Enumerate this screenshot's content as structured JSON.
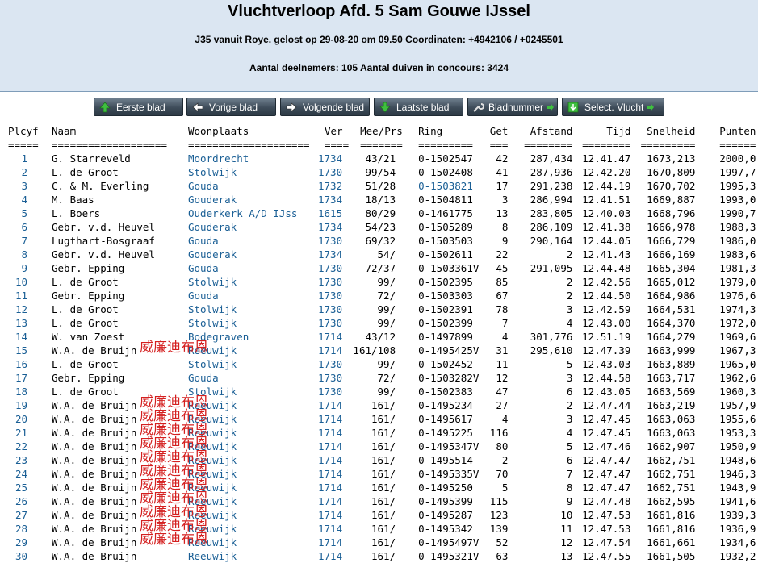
{
  "header": {
    "title": "Vluchtverloop Afd. 5 Sam Gouwe IJssel",
    "subtitle1": "J35 vanuit Roye. gelost op 29-08-20 om 09.50 Coordinaten: +4942106 / +0245501",
    "subtitle2": "Aantal deelnemers: 105 Aantal duiven in concours: 3424"
  },
  "toolbar": {
    "buttons": [
      {
        "name": "eerste-blad-button",
        "label": "Eerste blad",
        "icon": "arrow-up-icon"
      },
      {
        "name": "vorige-blad-button",
        "label": "Vorige blad",
        "icon": "arrow-left-icon"
      },
      {
        "name": "volgende-blad-button",
        "label": "Volgende blad",
        "icon": "arrow-right-icon"
      },
      {
        "name": "laatste-blad-button",
        "label": "Laatste blad",
        "icon": "arrow-down-icon"
      },
      {
        "name": "bladnummer-button",
        "label": "Bladnummer",
        "icon": "wrench-icon"
      },
      {
        "name": "select-vlucht-button",
        "label": "Select. Vlucht",
        "icon": "download-icon"
      }
    ]
  },
  "table": {
    "headers": [
      "Plcyf",
      "Naam",
      "Woonplaats",
      "Ver",
      "Mee/Prs",
      "Ring",
      "Get",
      "Afstand",
      "Tijd",
      "Snelheid",
      "Punten"
    ],
    "separators": [
      "=====",
      "===================",
      "====================",
      "====",
      "=======",
      "=========",
      "===",
      "========",
      "========",
      "=========",
      "======"
    ],
    "rows": [
      [
        "1",
        "G. Starreveld",
        "Moordrecht",
        "1734",
        "43/21",
        "0-1502547",
        "42",
        "287,434",
        "12.41.47",
        "1673,213",
        "2000,0"
      ],
      [
        "2",
        "L. de Groot",
        "Stolwijk",
        "1730",
        "99/54",
        "0-1502408",
        "41",
        "287,936",
        "12.42.20",
        "1670,809",
        "1997,7"
      ],
      [
        "3",
        "C. & M. Everling",
        "Gouda",
        "1732",
        "51/28",
        "0-1503821",
        "17",
        "291,238",
        "12.44.19",
        "1670,702",
        "1995,3"
      ],
      [
        "4",
        "M. Baas",
        "Gouderak",
        "1734",
        "18/13",
        "0-1504811",
        "3",
        "286,994",
        "12.41.51",
        "1669,887",
        "1993,0"
      ],
      [
        "5",
        "L. Boers",
        "Ouderkerk A/D IJss",
        "1615",
        "80/29",
        "0-1461775",
        "13",
        "283,805",
        "12.40.03",
        "1668,796",
        "1990,7"
      ],
      [
        "6",
        "Gebr. v.d. Heuvel",
        "Gouderak",
        "1734",
        "54/23",
        "0-1505289",
        "8",
        "286,109",
        "12.41.38",
        "1666,978",
        "1988,3"
      ],
      [
        "7",
        "Lugthart-Bosgraaf",
        "Gouda",
        "1730",
        "69/32",
        "0-1503503",
        "9",
        "290,164",
        "12.44.05",
        "1666,729",
        "1986,0"
      ],
      [
        "8",
        "Gebr. v.d. Heuvel",
        "Gouderak",
        "1734",
        "54/",
        "0-1502611",
        "22",
        "2",
        "12.41.43",
        "1666,169",
        "1983,6"
      ],
      [
        "9",
        "Gebr. Epping",
        "Gouda",
        "1730",
        "72/37",
        "0-1503361V",
        "45",
        "291,095",
        "12.44.48",
        "1665,304",
        "1981,3"
      ],
      [
        "10",
        "L. de Groot",
        "Stolwijk",
        "1730",
        "99/",
        "0-1502395",
        "85",
        "2",
        "12.42.56",
        "1665,012",
        "1979,0"
      ],
      [
        "11",
        "Gebr. Epping",
        "Gouda",
        "1730",
        "72/",
        "0-1503303",
        "67",
        "2",
        "12.44.50",
        "1664,986",
        "1976,6"
      ],
      [
        "12",
        "L. de Groot",
        "Stolwijk",
        "1730",
        "99/",
        "0-1502391",
        "78",
        "3",
        "12.42.59",
        "1664,531",
        "1974,3"
      ],
      [
        "13",
        "L. de Groot",
        "Stolwijk",
        "1730",
        "99/",
        "0-1502399",
        "7",
        "4",
        "12.43.00",
        "1664,370",
        "1972,0"
      ],
      [
        "14",
        "W. van Zoest",
        "Bodegraven",
        "1714",
        "43/12",
        "0-1497899",
        "4",
        "301,776",
        "12.51.19",
        "1664,279",
        "1969,6"
      ],
      [
        "15",
        "W.A. de Bruijn",
        "Reeuwijk",
        "1714",
        "161/108",
        "0-1495425V",
        "31",
        "295,610",
        "12.47.39",
        "1663,999",
        "1967,3"
      ],
      [
        "16",
        "L. de Groot",
        "Stolwijk",
        "1730",
        "99/",
        "0-1502452",
        "11",
        "5",
        "12.43.03",
        "1663,889",
        "1965,0"
      ],
      [
        "17",
        "Gebr. Epping",
        "Gouda",
        "1730",
        "72/",
        "0-1503282V",
        "12",
        "3",
        "12.44.58",
        "1663,717",
        "1962,6"
      ],
      [
        "18",
        "L. de Groot",
        "Stolwijk",
        "1730",
        "99/",
        "0-1502383",
        "47",
        "6",
        "12.43.05",
        "1663,569",
        "1960,3"
      ],
      [
        "19",
        "W.A. de Bruijn",
        "Reeuwijk",
        "1714",
        "161/",
        "0-1495234",
        "27",
        "2",
        "12.47.44",
        "1663,219",
        "1957,9"
      ],
      [
        "20",
        "W.A. de Bruijn",
        "Reeuwijk",
        "1714",
        "161/",
        "0-1495617",
        "4",
        "3",
        "12.47.45",
        "1663,063",
        "1955,6"
      ],
      [
        "21",
        "W.A. de Bruijn",
        "Reeuwijk",
        "1714",
        "161/",
        "0-1495225",
        "116",
        "4",
        "12.47.45",
        "1663,063",
        "1953,3"
      ],
      [
        "22",
        "W.A. de Bruijn",
        "Reeuwijk",
        "1714",
        "161/",
        "0-1495347V",
        "80",
        "5",
        "12.47.46",
        "1662,907",
        "1950,9"
      ],
      [
        "23",
        "W.A. de Bruijn",
        "Reeuwijk",
        "1714",
        "161/",
        "0-1495514",
        "2",
        "6",
        "12.47.47",
        "1662,751",
        "1948,6"
      ],
      [
        "24",
        "W.A. de Bruijn",
        "Reeuwijk",
        "1714",
        "161/",
        "0-1495335V",
        "70",
        "7",
        "12.47.47",
        "1662,751",
        "1946,3"
      ],
      [
        "25",
        "W.A. de Bruijn",
        "Reeuwijk",
        "1714",
        "161/",
        "0-1495250",
        "5",
        "8",
        "12.47.47",
        "1662,751",
        "1943,9"
      ],
      [
        "26",
        "W.A. de Bruijn",
        "Reeuwijk",
        "1714",
        "161/",
        "0-1495399",
        "115",
        "9",
        "12.47.48",
        "1662,595",
        "1941,6"
      ],
      [
        "27",
        "W.A. de Bruijn",
        "Reeuwijk",
        "1714",
        "161/",
        "0-1495287",
        "123",
        "10",
        "12.47.53",
        "1661,816",
        "1939,3"
      ],
      [
        "28",
        "W.A. de Bruijn",
        "Reeuwijk",
        "1714",
        "161/",
        "0-1495342",
        "139",
        "11",
        "12.47.53",
        "1661,816",
        "1936,9"
      ],
      [
        "29",
        "W.A. de Bruijn",
        "Reeuwijk",
        "1714",
        "161/",
        "0-1495497V",
        "52",
        "12",
        "12.47.54",
        "1661,661",
        "1934,6"
      ],
      [
        "30",
        "W.A. de Bruijn",
        "Reeuwijk",
        "1714",
        "161/",
        "0-1495321V",
        "63",
        "13",
        "12.47.55",
        "1661,505",
        "1932,2"
      ]
    ]
  },
  "watermark": "威廉迪布恩",
  "colors": {
    "header_bg": "#dbe6f2",
    "link_blue": "#1a5f95",
    "watermark_red": "#d42020",
    "button_dark": "#3e4c59"
  }
}
